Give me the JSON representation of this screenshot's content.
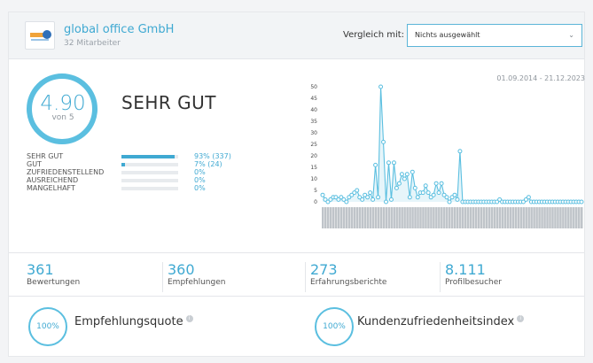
{
  "company": {
    "name": "global office GmbH",
    "employees": "32 Mitarbeiter"
  },
  "compare": {
    "label": "Vergleich mit:",
    "selected": "Nichts ausgewählt"
  },
  "rating": {
    "score": "4.90",
    "of": "von 5",
    "grade": "SEHR GUT"
  },
  "distribution": [
    {
      "label": "SEHR GUT",
      "pct_text": "93% (337)",
      "fraction": 0.93
    },
    {
      "label": "GUT",
      "pct_text": "7% (24)",
      "fraction": 0.07
    },
    {
      "label": "ZUFRIEDENSTELLEND",
      "pct_text": "0%",
      "fraction": 0
    },
    {
      "label": "AUSREICHEND",
      "pct_text": "0%",
      "fraction": 0
    },
    {
      "label": "MANGELHAFT",
      "pct_text": "0%",
      "fraction": 0
    }
  ],
  "date_range": "01.09.2014 - 21.12.2023",
  "chart_data": {
    "type": "line",
    "ylim": [
      0,
      50
    ],
    "yticks": [
      0,
      5,
      10,
      15,
      20,
      25,
      30,
      35,
      40,
      45,
      50
    ],
    "series": [
      {
        "values": [
          3,
          1,
          0,
          1,
          2,
          2,
          1,
          2,
          1,
          0,
          2,
          3,
          4,
          5,
          2,
          1,
          3,
          2,
          4,
          1,
          16,
          2,
          50,
          26,
          0,
          17,
          1,
          17,
          6,
          8,
          12,
          10,
          12,
          2,
          13,
          6,
          2,
          4,
          4,
          7,
          4,
          2,
          3,
          8,
          4,
          8,
          3,
          2,
          0,
          2,
          3,
          1,
          22,
          0,
          0,
          0,
          0,
          0,
          0,
          0,
          0,
          0,
          0,
          0,
          0,
          0,
          0,
          1,
          0,
          0,
          0,
          0,
          0,
          0,
          0,
          0,
          0,
          1,
          2,
          0,
          0,
          0,
          0,
          0,
          0,
          0,
          0,
          0,
          0,
          0,
          0,
          0,
          0,
          0,
          0,
          0,
          0,
          0,
          0
        ]
      }
    ],
    "color": "#5bbfe0"
  },
  "stats": [
    {
      "value": "361",
      "label": "Bewertungen"
    },
    {
      "value": "360",
      "label": "Empfehlungen"
    },
    {
      "value": "273",
      "label": "Erfahrungsberichte"
    },
    {
      "value": "8.111",
      "label": "Profilbesucher"
    }
  ],
  "metrics": [
    {
      "pct": "100%",
      "label": "Empfehlungsquote"
    },
    {
      "pct": "100%",
      "label": "Kundenzufriedenheitsindex"
    }
  ],
  "icons": {
    "dropdown": "chevron-down-icon",
    "info": "info-icon"
  }
}
